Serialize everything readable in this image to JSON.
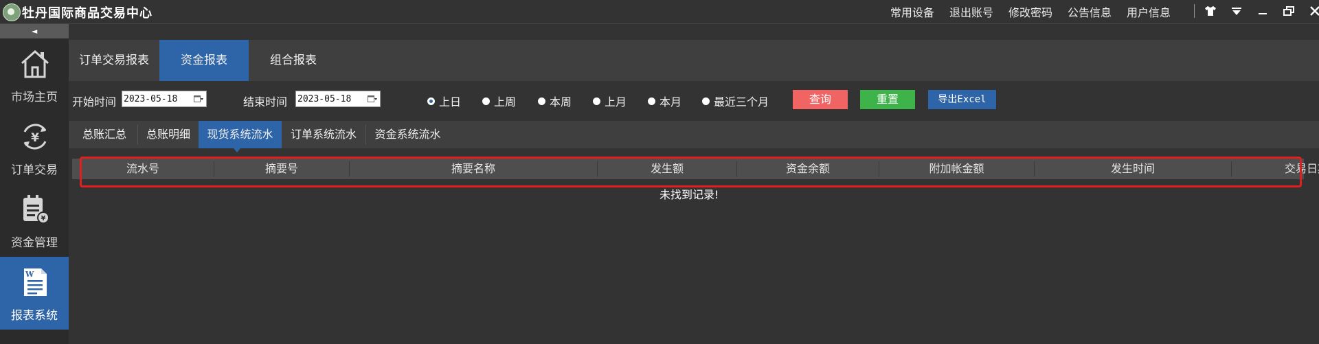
{
  "app": {
    "title": "牡丹国际商品交易中心"
  },
  "topmenu": [
    "常用设备",
    "退出账号",
    "修改密码",
    "公告信息",
    "用户信息"
  ],
  "window_controls": [
    "skin-icon",
    "dropdown-icon",
    "minimize-icon",
    "restore-icon",
    "close-icon"
  ],
  "sidebar": {
    "collapse": "◄",
    "items": [
      {
        "label": "市场主页",
        "icon": "home-icon",
        "active": false
      },
      {
        "label": "订单交易",
        "icon": "yen-exchange-icon",
        "active": false
      },
      {
        "label": "资金管理",
        "icon": "clipboard-yen-icon",
        "active": false
      },
      {
        "label": "报表系统",
        "icon": "document-icon",
        "active": true
      }
    ]
  },
  "main_tabs": [
    {
      "label": "订单交易报表",
      "active": false
    },
    {
      "label": "资金报表",
      "active": true
    },
    {
      "label": "组合报表",
      "active": false
    }
  ],
  "filter": {
    "start_label": "开始时间",
    "start_value": "2023-05-18",
    "end_label": "结束时间",
    "end_value": "2023-05-18",
    "radios": [
      {
        "label": "上日",
        "selected": true
      },
      {
        "label": "上周",
        "selected": false
      },
      {
        "label": "本周",
        "selected": false
      },
      {
        "label": "上月",
        "selected": false
      },
      {
        "label": "本月",
        "selected": false
      },
      {
        "label": "最近三个月",
        "selected": false
      }
    ],
    "buttons": {
      "query": "查询",
      "reset": "重置",
      "export": "导出Excel"
    }
  },
  "sub_tabs": [
    {
      "label": "总账汇总",
      "active": false
    },
    {
      "label": "总账明细",
      "active": false
    },
    {
      "label": "现货系统流水",
      "active": true
    },
    {
      "label": "订单系统流水",
      "active": false
    },
    {
      "label": "资金系统流水",
      "active": false
    }
  ],
  "table": {
    "columns": [
      "流水号",
      "摘要号",
      "摘要名称",
      "发生额",
      "资金余额",
      "附加帐金额",
      "发生时间",
      "交易日期"
    ],
    "empty_text": "未找到记录!"
  },
  "colors": {
    "accent": "#2e64a8",
    "query": "#f06464",
    "reset": "#3db34a",
    "export": "#2e64a8",
    "highlight": "#e02020"
  }
}
